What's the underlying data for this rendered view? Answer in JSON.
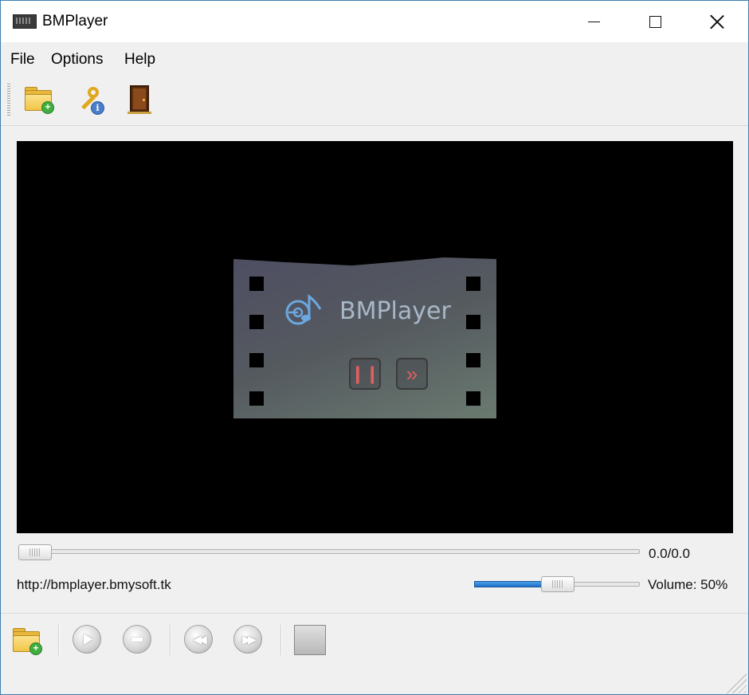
{
  "window": {
    "title": "BMPlayer",
    "minimize_glyph": "",
    "maximize_glyph": "",
    "close_glyph": ""
  },
  "menu": {
    "items": [
      {
        "label": "File"
      },
      {
        "label": "Options"
      },
      {
        "label": "Help"
      }
    ]
  },
  "toolbar": {
    "icons": [
      "open-folder-icon",
      "key-info-icon",
      "exit-door-icon"
    ]
  },
  "video": {
    "logo_text": "BMPlayer",
    "pause_glyph": "❙❙",
    "forward_glyph": "»"
  },
  "seek": {
    "position_fraction": 0.0,
    "time": "0.0/0.0"
  },
  "status": {
    "url": "http://bmplayer.bmysoft.tk",
    "volume_label": "Volume",
    "volume_value": "50%",
    "volume_level": 0.5
  },
  "controls": {
    "icons": [
      "add-folder-icon",
      "play-icon",
      "stop-icon",
      "rewind-icon",
      "fast-forward-icon",
      "fullscreen-square-icon"
    ],
    "rewind_glyph": "◀◀",
    "forward_glyph": "▶▶"
  },
  "colors": {
    "accent": "#1e6ec8",
    "video_bg": "#000000",
    "window_border": "#3c7fb1"
  }
}
